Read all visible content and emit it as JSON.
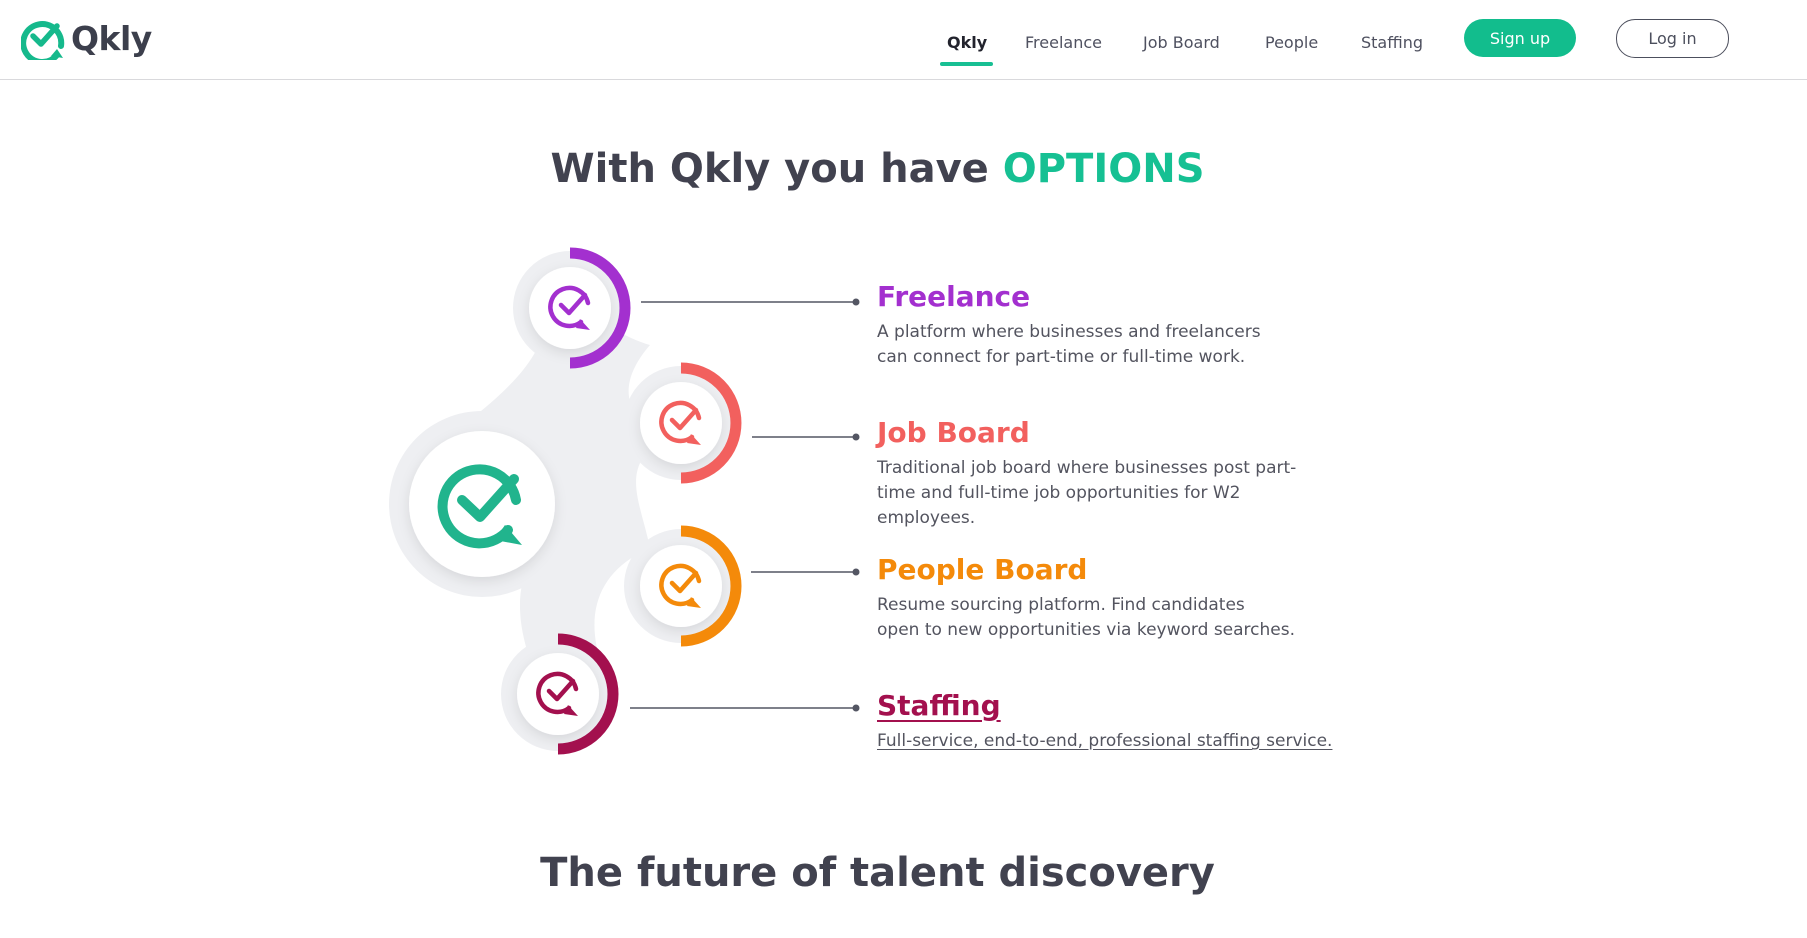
{
  "brand": {
    "name": "Qkly",
    "logo_icon": "qkly-check-bubble-icon",
    "accent": "#12bd8d"
  },
  "nav": {
    "items": [
      {
        "label": "Qkly",
        "active": true
      },
      {
        "label": "Freelance",
        "active": false
      },
      {
        "label": "Job Board",
        "active": false
      },
      {
        "label": "People",
        "active": false
      },
      {
        "label": "Staffing",
        "active": false
      }
    ],
    "signup_label": "Sign up",
    "login_label": "Log in"
  },
  "hero": {
    "headline_prefix": "With Qkly you have ",
    "headline_accent": "OPTIONS"
  },
  "options": [
    {
      "title": "Freelance",
      "color": "#a330cf",
      "desc_lines": [
        "A platform where businesses and freelancers",
        "can connect for part-time or full-time work."
      ]
    },
    {
      "title": "Job Board",
      "color": "#f2605e",
      "desc_lines": [
        "Traditional job board where businesses post part-",
        "time and full-time job opportunities for W2",
        "employees."
      ]
    },
    {
      "title": "People Board",
      "color": "#f48a0a",
      "desc_lines": [
        "Resume sourcing platform. Find candidates",
        "open to new opportunities via keyword searches."
      ]
    },
    {
      "title": "Staffing",
      "color": "#a3104e",
      "desc_lines": [
        "Full-service, end-to-end, professional staffing service."
      ]
    }
  ],
  "section2": {
    "title": "The future of talent discovery"
  }
}
